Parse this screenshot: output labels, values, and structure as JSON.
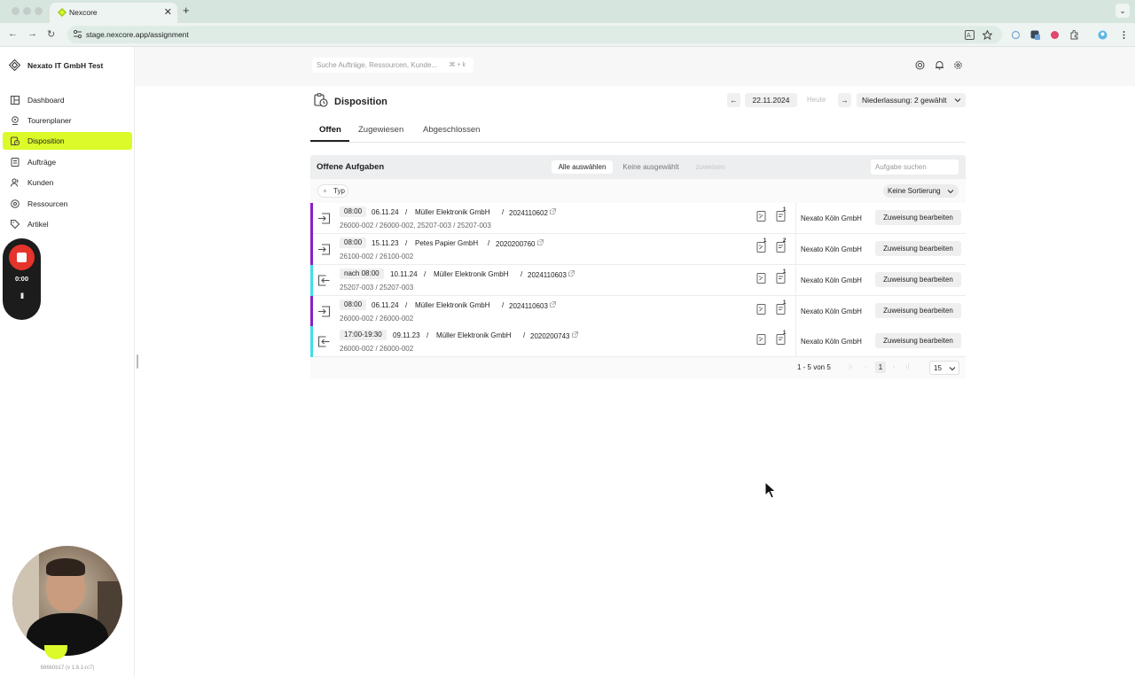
{
  "browser": {
    "tab_title": "Nexcore",
    "tab_close": "✕",
    "new_tab": "+",
    "tab_menu": "⌄",
    "url": "stage.nexcore.app/assignment",
    "nav_back": "←",
    "nav_forward": "→",
    "nav_reload": "↻"
  },
  "sidebar": {
    "org_name": "Nexato IT GmbH Test",
    "items": [
      {
        "label": "Dashboard",
        "icon": "dashboard-icon"
      },
      {
        "label": "Tourenplaner",
        "icon": "map-pin-icon"
      },
      {
        "label": "Disposition",
        "icon": "clipboard-clock-icon",
        "active": true
      },
      {
        "label": "Aufträge",
        "icon": "document-icon"
      },
      {
        "label": "Kunden",
        "icon": "people-icon"
      },
      {
        "label": "Ressourcen",
        "icon": "server-icon"
      },
      {
        "label": "Artikel",
        "icon": "tag-icon"
      }
    ],
    "version": "686b0b17 (v 1.8.1-rc7)"
  },
  "recorder": {
    "time": "0:00",
    "pause": "II"
  },
  "topbar": {
    "search_placeholder": "Suche Aufträge, Ressourcen, Kunde...",
    "search_shortcut": "⌘ + k"
  },
  "page": {
    "title": "Disposition",
    "date_prev": "←",
    "date": "22.11.2024",
    "today": "Heute",
    "date_next": "→",
    "branch_select": "Niederlassung: 2 gewählt"
  },
  "tabs": [
    {
      "label": "Offen",
      "active": true
    },
    {
      "label": "Zugewiesen"
    },
    {
      "label": "Abgeschlossen"
    }
  ],
  "panel": {
    "title": "Offene Aufgaben",
    "select_all": "Alle auswählen",
    "none_selected": "Keine ausgewählt",
    "assign": "zuweisen",
    "task_search_placeholder": "Aufgabe suchen",
    "filter_type": "Typ",
    "filter_plus": "+",
    "sort": "Keine Sortierung"
  },
  "colors": {
    "accent": "#dcfa2a",
    "outbound": "#8a1fc7",
    "inbound": "#3fe0e6"
  },
  "rows": [
    {
      "direction": "outbound",
      "time": "08:00",
      "date": "06.11.24",
      "sep1": "/",
      "customer": "Müller Elektronik GmbH",
      "sep2": "/",
      "order": "2024110602",
      "sub": "26000-002 / 26000-002, 25207-003 / 25207-003",
      "badge_a": "",
      "badge_b": "1",
      "branch": "Nexato Köln GmbH",
      "action": "Zuweisung bearbeiten"
    },
    {
      "direction": "outbound",
      "time": "08:00",
      "date": "15.11.23",
      "sep1": "/",
      "customer": "Petes Papier GmbH",
      "sep2": "/",
      "order": "2020200760",
      "sub": "26100-002 / 26100-002",
      "badge_a": "1",
      "badge_b": "2",
      "branch": "Nexato Köln GmbH",
      "action": "Zuweisung bearbeiten"
    },
    {
      "direction": "inbound",
      "time": "nach 08:00",
      "date": "10.11.24",
      "sep1": "/",
      "customer": "Müller Elektronik GmbH",
      "sep2": "/",
      "order": "2024110603",
      "sub": "25207-003 / 25207-003",
      "badge_a": "",
      "badge_b": "1",
      "branch": "Nexato Köln GmbH",
      "action": "Zuweisung bearbeiten"
    },
    {
      "direction": "outbound",
      "time": "08:00",
      "date": "06.11.24",
      "sep1": "/",
      "customer": "Müller Elektronik GmbH",
      "sep2": "/",
      "order": "2024110603",
      "sub": "26000-002 / 26000-002",
      "badge_a": "",
      "badge_b": "1",
      "branch": "Nexato Köln GmbH",
      "action": "Zuweisung bearbeiten"
    },
    {
      "direction": "inbound",
      "time": "17:00-19:30",
      "date": "09.11.23",
      "sep1": "/",
      "customer": "Müller Elektronik GmbH",
      "sep2": "/",
      "order": "2020200743",
      "sub": "26000-002 / 26000-002",
      "badge_a": "",
      "badge_b": "1",
      "branch": "Nexato Köln GmbH",
      "action": "Zuweisung bearbeiten"
    }
  ],
  "pagination": {
    "range": "1 - 5 von 5",
    "first": "|‹",
    "prev": "‹",
    "page": "1",
    "next": "›",
    "last": "›|",
    "page_size": "15"
  }
}
